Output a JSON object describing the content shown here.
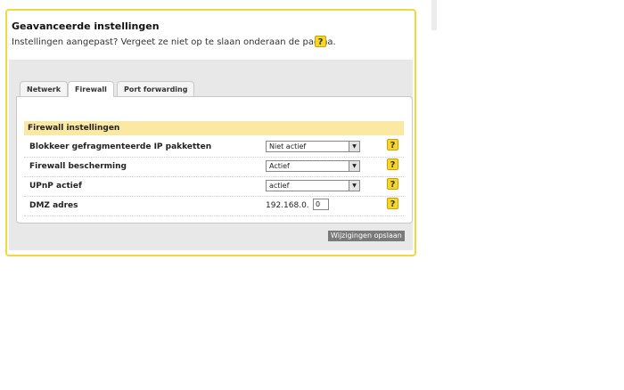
{
  "header": {
    "title": "Geavanceerde instellingen",
    "subtitle": "Instellingen aangepast? Vergeet ze niet op te slaan onderaan de pagina.",
    "help_label": "?"
  },
  "tabs": [
    {
      "label": "Netwerk",
      "active": false
    },
    {
      "label": "Firewall",
      "active": true
    },
    {
      "label": "Port forwarding",
      "active": false
    }
  ],
  "section": {
    "title": "Firewall instellingen",
    "rows": [
      {
        "label": "Blokkeer gefragmenteerde IP pakketten",
        "value": "Niet actief",
        "help": "?"
      },
      {
        "label": "Firewall bescherming",
        "value": "Actief",
        "help": "?"
      },
      {
        "label": "UPnP actief",
        "value": "actief",
        "help": "?"
      },
      {
        "label": "DMZ adres",
        "ip_prefix": "192.168.0.",
        "ip_last": "0",
        "help": "?"
      }
    ]
  },
  "save_button": "Wijzigingen opslaan",
  "colors": {
    "accent_border": "#f2d83d",
    "section_header": "#fbe9a3",
    "help_icon": "#f6d629"
  }
}
